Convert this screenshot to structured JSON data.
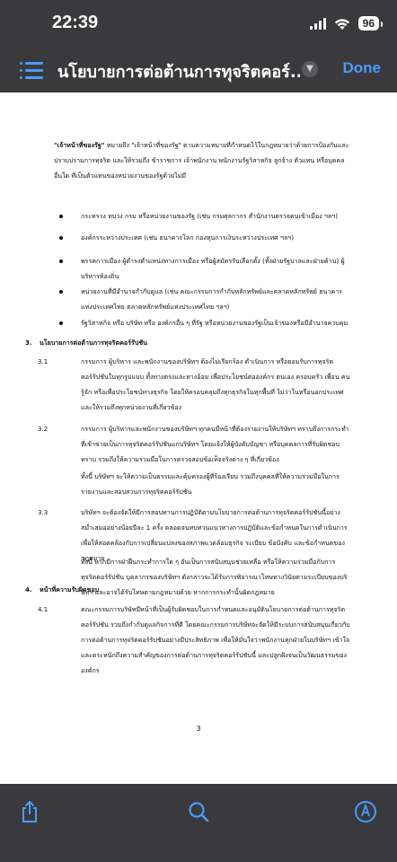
{
  "status": {
    "time": "22:39",
    "battery": "96"
  },
  "nav": {
    "title": "นโยบายการต่อต้านการทุจริตคอร์...",
    "done_label": "Done"
  },
  "doc": {
    "intro_term": "\"เจ้าหน้าที่ของรัฐ\"",
    "intro_rest": " หมายถึง \"เจ้าหน้าที่ของรัฐ\" ตามความหมายที่กำหนดไว้ในกฎหมายว่าด้วยการป้องกันและปราบปรามการทุจริต และให้รวมถึง ข้าราชการ เจ้าพนักงาน พนักงานรัฐวิสาหกิจ ลูกจ้าง ตัวแทน หรือบุคคลอื่นใด ที่เป็นตัวแทนของหน่วยงานของรัฐด้วยไม่มี",
    "bullets": [
      "กระทรวง ทบวง กรม หรือหน่วยงานของรัฐ (เช่น กรมศุลกากร สำนักงานตรวจคนเข้าเมือง ฯลฯ)",
      "องค์กรระหว่างประเทศ (เช่น ธนาคารโลก กองทุนการเงินระหว่างประเทศ ฯลฯ)",
      "พรรคการเมือง ผู้ดำรงตำแหน่งทางการเมือง หรือผู้สมัครรับเลือกตั้ง (ทั้งฝ่ายรัฐบาลและฝ่ายค้าน) ผู้บริหารท้องถิ่น",
      "หน่วยงานที่มีอำนาจกำกับดูแล (เช่น คณะกรรมการกำกับหลักทรัพย์และตลาดหลักทรัพย์ ธนาคารแห่งประเทศไทย ตลาดหลักทรัพย์แห่งประเทศไทย ฯลฯ)",
      "รัฐวิสาหกิจ หรือ บริษัท หรือ องค์กรอื่น ๆ ที่รัฐ หรือหน่วยงานของรัฐเป็นเจ้าของหรือมีอำนาจควบคุม"
    ],
    "section3": {
      "num": "3.",
      "title": "นโยบายการต่อต้านการทุจริตคอร์รัปชัน"
    },
    "items3": [
      {
        "num": "3.1",
        "text": "กรรมการ ผู้บริหาร และพนักงานของบริษัทฯ ต้องไม่เรียกร้อง ดำเนินการ หรือยอมรับการทุจริตคอร์รัปชันในทุกรูปแบบ ทั้งทางตรงและทางอ้อม เพื่อประโยชน์ต่อองค์กร ตนเอง ครอบครัว เพื่อน คนรู้จัก หรือเพื่อประโยชน์ทางธุรกิจ โดยให้ครอบคลุมถึงทุกธุรกิจในทุกพื้นที่ ไม่ว่าในหรือนอกประเทศ และให้รวมถึงทุกหน่วยงานที่เกี่ยวข้อง"
      },
      {
        "num": "3.2",
        "text": "กรรมการ ผู้บริหารและพนักงานของบริษัทฯ ทุกคนมีหน้าที่ต้องรายงานให้บริษัทฯ ทราบถึงการกระทำที่เข้าข่ายเป็นการทุจริตคอร์รัปชันแก่บริษัทฯ โดยแจ้งให้ผู้บังคับบัญชา หรือบุคคลการที่รับผิดชอบทราบ รวมถึงให้ความร่วมมือในการตรวจสอบข้อเท็จจริงต่าง ๆ ที่เกี่ยวข้อง",
        "extra": "ทั้งนี้ บริษัทฯ จะให้ความเป็นธรรมและคุ้มครองผู้ที่ร้องเรียน รวมถึงบุคคลที่ให้ความร่วมมือในการรายงานและสอบสวนการทุจริตคอร์รัปชัน"
      },
      {
        "num": "3.3",
        "text": "บริษัทฯ จะต้องจัดให้มีการสอบทานการปฏิบัติตามนโยบายการต่อต้านการทุจริตคอร์รัปชันนี้อย่างสม่ำเสมออย่างน้อยปีละ 1 ครั้ง ตลอดจนทบทวนแนวทางการปฏิบัติและข้อกำหนดในการดำเนินการเพื่อให้สอดคล้องกับการเปลี่ยนแปลงของสภาพแวดล้อมธุรกิจ ระเบียบ ข้อบังคับ และข้อกำหนดของกฎหมาย",
        "extra": "ทั้งนี้ หากมีการฝ่าฝืนกระทำการใด ๆ อันเป็นการสนับสนุนช่วยเหลือ หรือให้ความร่วมมือกับการทุจริตคอร์รัปชัน บุคลากรของบริษัทฯ ดังกล่าวจะได้รับการพิจารณาโทษทางวินัยตามระเบียบของบริษัทฯ และอาจได้รับโทษตามกฎหมายด้วย หากการกระทำนั้นผิดกฎหมาย"
      }
    ],
    "section4": {
      "num": "4.",
      "title": "หน้าที่ความรับผิดชอบ"
    },
    "items4": [
      {
        "num": "4.1",
        "text": "คณะกรรมการบริษัทมีหน้าที่เป็นผู้รับผิดชอบในการกำหนดและอนุมัตินโยบายการต่อต้านการทุจริตคอร์รัปชัน รวมถึงกำกับดูแลกิจการที่ดี โดยคณะกรรมการบริษัทจะจัดให้มีระบบการสนับสนุนเกี่ยวกับการต่อต้านการทุจริตคอร์รัปชันอย่างมีประสิทธิภาพ เพื่อให้มั่นใจว่าพนักงานทุกฝ่ายในบริษัทฯ เข้าใจ และตระหนักถึงความสำคัญของการต่อต้านการทุจริตคอร์รัปชันนี้ และปลูกฝังจนเป็นวัฒนธรรมขององค์กร"
      }
    ],
    "page_number": "3"
  },
  "toolbar": {
    "share_icon": "share-icon",
    "search_icon": "search-icon",
    "markup_icon": "markup-icon"
  },
  "colors": {
    "accent": "#4a9bff",
    "bar_bg": "#3a3a3c"
  }
}
